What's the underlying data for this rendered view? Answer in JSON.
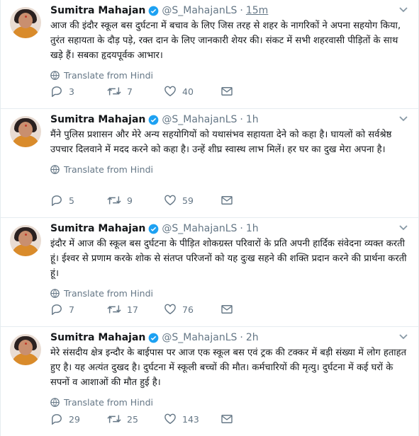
{
  "tweets": [
    {
      "name": "Sumitra Mahajan",
      "handle": "@S_MahajanLS",
      "time": "15m",
      "text": "आज की इंदौर स्कूल बस दुर्घटना में बचाव के लिए जिस तरह से शहर के नागरिकों ने अपना सहयोग किया, तुरंत सहायता के दौड़ पड़े, रक्त दान के लिए जानकारी शेयर की। संकट में सभी शहरवासी पीड़ितों के साथ खड़े हैं। सबका हृदयपूर्वक आभार।",
      "translate": "Translate from Hindi",
      "replies": "3",
      "retweets": "7",
      "likes": "40"
    },
    {
      "name": "Sumitra Mahajan",
      "handle": "@S_MahajanLS",
      "time": "1h",
      "text": "मैंने पुलिस प्रशासन और मेरे अन्य सहयोगियों को  यथासंभव सहायता देने को कहा है। घायलों को सर्वश्रेष्ठ उपचार दिलवाने में मदद करने को कहा है। उन्हें शीघ्र स्वास्थ लाभ मिलें। हर घर का दुख मेरा अपना है।",
      "translate": "Translate from Hindi",
      "replies": "5",
      "retweets": "9",
      "likes": "59"
    },
    {
      "name": "Sumitra Mahajan",
      "handle": "@S_MahajanLS",
      "time": "1h",
      "text": "इंदौर में आज की स्कूल बस दुर्घटना के पीड़ित  शोकग्रस्त परिवारों के प्रति अपनी हार्दिक संवेदना व्यक्त करती हूं। ईश्वर से प्रणाम करके शोक से संतप्त परिजनों को यह दुःख सहने की शक्ति प्रदान करने की प्रार्थना करती हूं।",
      "translate": "Translate from Hindi",
      "replies": "7",
      "retweets": "17",
      "likes": "76"
    },
    {
      "name": "Sumitra Mahajan",
      "handle": "@S_MahajanLS",
      "time": "2h",
      "text": "मेरे संसदीय क्षेत्र इन्दौर के बाईपास पर आज एक स्कूल बस एवं ट्रक की टक्कर में बड़ी संख्या में लोग हताहत हुए है। यह अत्यंत दुखद है। दुर्घटना में स्कूली बच्चों की मौत। कर्मचारियों की मृत्यु। दुर्घटना में कई घरों के सपनों व आशाओं की मौत हुई है।",
      "translate": "Translate from Hindi",
      "replies": "29",
      "retweets": "25",
      "likes": "143"
    }
  ],
  "colors": {
    "verified": "#1da1f2",
    "muted": "#657786",
    "border": "#e6ecf0"
  },
  "icons": [
    "globe-icon",
    "reply-icon",
    "retweet-icon",
    "like-icon",
    "direct-message-icon",
    "verified-badge-icon",
    "caret-down-icon"
  ]
}
